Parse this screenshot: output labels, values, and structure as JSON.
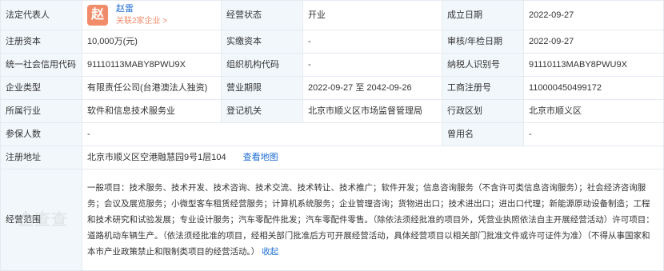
{
  "rows": {
    "legal_rep": {
      "label": "法定代表人",
      "name": "赵雷",
      "avatar_char": "赵",
      "related": "关联2家企业 >"
    },
    "status": {
      "label": "经营状态",
      "value": "开业"
    },
    "founded": {
      "label": "成立日期",
      "value": "2022-09-27"
    },
    "reg_capital": {
      "label": "注册资本",
      "value": "10,000万(元)"
    },
    "paid_capital": {
      "label": "实缴资本",
      "value": "-"
    },
    "approval_date": {
      "label": "审核/年检日期",
      "value": "2022-09-27"
    },
    "credit_code": {
      "label": "统一社会信用代码",
      "value": "91110113MABY8PWU9X"
    },
    "org_code": {
      "label": "组织机构代码",
      "value": "-"
    },
    "tax_id": {
      "label": "纳税人识别号",
      "value": "91110113MABY8PWU9X"
    },
    "company_type": {
      "label": "企业类型",
      "value": "有限责任公司(台港澳法人独资)"
    },
    "business_term": {
      "label": "营业期限",
      "value": "2022-09-27 至 2042-09-26"
    },
    "reg_number": {
      "label": "工商注册号",
      "value": "110000450499172"
    },
    "industry": {
      "label": "所属行业",
      "value": "软件和信息技术服务业"
    },
    "reg_authority": {
      "label": "登记机关",
      "value": "北京市顺义区市场监督管理局"
    },
    "district": {
      "label": "行政区划",
      "value": "北京市顺义区"
    },
    "insured": {
      "label": "参保人数",
      "value": "-"
    },
    "former_name": {
      "label": "曾用名",
      "value": "-"
    },
    "address": {
      "label": "注册地址",
      "value": "北京市顺义区空港融慧园9号1层104",
      "map_link": "查看地图"
    },
    "scope": {
      "label": "经营范围",
      "text": "一般项目：技术服务、技术开发、技术咨询、技术交流、技术转让、技术推广；软件开发；信息咨询服务（不含许可类信息咨询服务）；社会经济咨询服务；会议及展览服务；小微型客车租赁经营服务；计算机系统服务；企业管理咨询；货物进出口；技术进出口；进出口代理；新能源原动设备制造；工程和技术研究和试验发展；专业设计服务；汽车零配件批发；汽车零配件零售。（除依法须经批准的项目外，凭营业执照依法自主开展经营活动）许可项目：道路机动车辆生产。（依法须经批准的项目，经相关部门批准后方可开展经营活动，具体经营项目以相关部门批准文件或许可证件为准）（不得从事国家和本市产业政策禁止和限制类项目的经营活动。）",
      "collapse": "收起"
    }
  },
  "watermark": "企查查",
  "colors": {
    "label_bg": "#f2f7fb",
    "border": "#e4eaf1",
    "link": "#1d6dd4",
    "avatar": "#f08c6a"
  }
}
